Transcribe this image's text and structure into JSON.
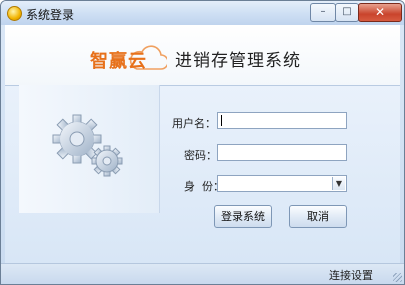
{
  "window": {
    "title": "系统登录",
    "controls": {
      "minimize": "–",
      "maximize": "□",
      "close": "✕"
    }
  },
  "banner": {
    "brand": "智赢云",
    "app_title": "进销存管理系统"
  },
  "illustration": {
    "icon": "gears-icon"
  },
  "form": {
    "username_label": "用户名：",
    "username_value": "",
    "password_label": "密码：",
    "password_value": "",
    "role_label": "身  份：",
    "role_value": ""
  },
  "buttons": {
    "login": "登录系统",
    "cancel": "取消"
  },
  "statusbar": {
    "connection_settings": "连接设置"
  },
  "colors": {
    "brand_orange": "#e7711b",
    "window_blue": "#c9dbf0"
  }
}
